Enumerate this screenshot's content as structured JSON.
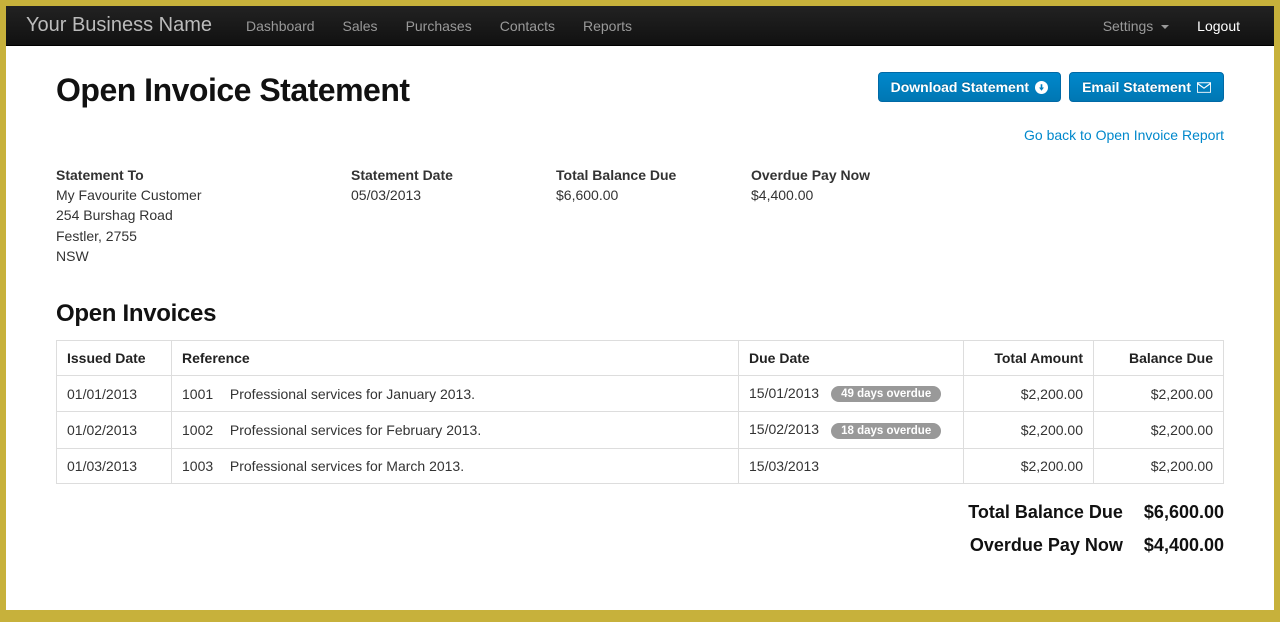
{
  "nav": {
    "brand": "Your Business Name",
    "items": [
      "Dashboard",
      "Sales",
      "Purchases",
      "Contacts",
      "Reports"
    ],
    "settings": "Settings",
    "logout": "Logout"
  },
  "page": {
    "title": "Open Invoice Statement",
    "download_btn": "Download Statement",
    "email_btn": "Email Statement",
    "back_link": "Go back to Open Invoice Report"
  },
  "summary": {
    "to_label": "Statement To",
    "to_name": "My Favourite Customer",
    "to_addr1": "254 Burshag Road",
    "to_addr2": "Festler,  2755",
    "to_addr3": "NSW",
    "date_label": "Statement Date",
    "date_value": "05/03/2013",
    "balance_label": "Total Balance Due",
    "balance_value": "$6,600.00",
    "overdue_label": "Overdue Pay Now",
    "overdue_value": "$4,400.00"
  },
  "section_title": "Open Invoices",
  "table": {
    "headers": {
      "issued": "Issued Date",
      "reference": "Reference",
      "due": "Due Date",
      "total": "Total Amount",
      "balance": "Balance Due"
    },
    "rows": [
      {
        "issued": "01/01/2013",
        "ref_num": "1001",
        "ref_desc": "Professional services for January 2013.",
        "due": "15/01/2013",
        "overdue_badge": "49 days overdue",
        "total": "$2,200.00",
        "balance": "$2,200.00"
      },
      {
        "issued": "01/02/2013",
        "ref_num": "1002",
        "ref_desc": "Professional services for February 2013.",
        "due": "15/02/2013",
        "overdue_badge": "18 days overdue",
        "total": "$2,200.00",
        "balance": "$2,200.00"
      },
      {
        "issued": "01/03/2013",
        "ref_num": "1003",
        "ref_desc": "Professional services for March 2013.",
        "due": "15/03/2013",
        "overdue_badge": "",
        "total": "$2,200.00",
        "balance": "$2,200.00"
      }
    ]
  },
  "totals": {
    "balance_label": "Total Balance Due",
    "balance_value": "$6,600.00",
    "overdue_label": "Overdue Pay Now",
    "overdue_value": "$4,400.00"
  }
}
